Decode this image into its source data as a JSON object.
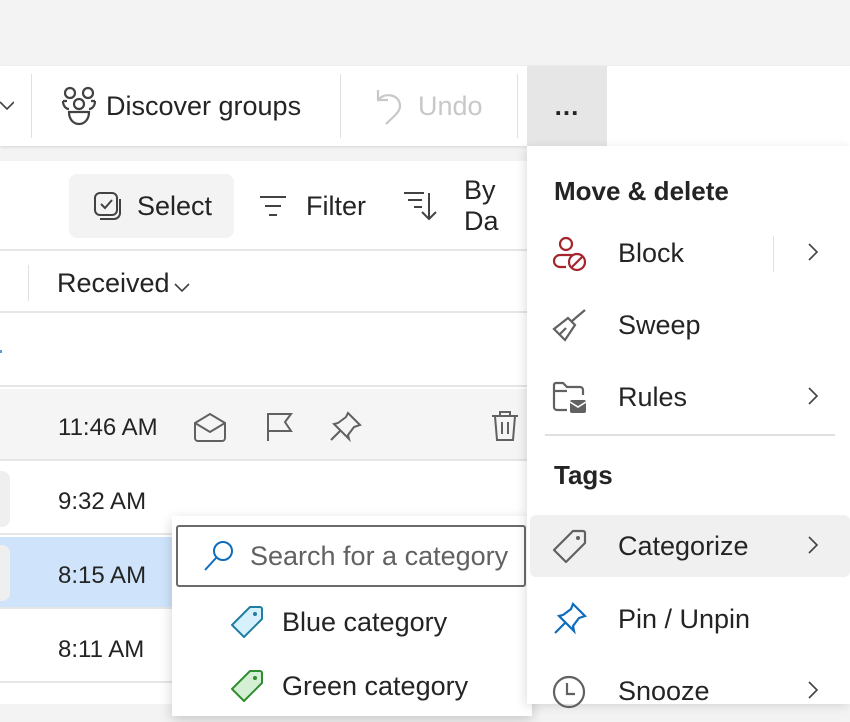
{
  "ribbon": {
    "discover_groups_label": "Discover groups",
    "undo_label": "Undo",
    "more_label": "..."
  },
  "list": {
    "commands": {
      "select_label": "Select",
      "filter_label": "Filter",
      "sort_label": "By Da"
    },
    "column_header": {
      "received_label": "Received"
    },
    "rows": [
      {
        "time": ""
      },
      {
        "time": "11:46 AM",
        "hover_actions": [
          "mark-read-icon",
          "flag-icon",
          "pin-icon",
          "delete-icon"
        ]
      },
      {
        "time": "9:32 AM"
      },
      {
        "time": "8:15 AM",
        "selected": true
      },
      {
        "time": "8:11 AM"
      }
    ]
  },
  "categorize_flyout": {
    "search_placeholder": "Search for a category",
    "categories": [
      {
        "label": "Blue category",
        "color": "#1f7ea1",
        "fill": "#d6f1fb"
      },
      {
        "label": "Green category",
        "color": "#2f8f2f",
        "fill": "#d5efd5"
      }
    ]
  },
  "menu": {
    "sections": [
      {
        "header": "Move & delete",
        "items": [
          {
            "label": "Block",
            "icon": "block-person-icon",
            "submenu": true,
            "split": true
          },
          {
            "label": "Sweep",
            "icon": "broom-icon",
            "submenu": false
          },
          {
            "label": "Rules",
            "icon": "rules-folder-icon",
            "submenu": true
          }
        ]
      },
      {
        "header": "Tags",
        "items": [
          {
            "label": "Categorize",
            "icon": "tag-icon",
            "submenu": true,
            "highlighted": true
          },
          {
            "label": "Pin / Unpin",
            "icon": "pin-icon",
            "submenu": false
          },
          {
            "label": "Snooze",
            "icon": "clock-icon",
            "submenu": true
          }
        ]
      }
    ]
  },
  "colors": {
    "accent": "#0f6cbd",
    "block_icon": "#a4262c",
    "selected_row": "#cfe4fa",
    "hover_row": "#f5f5f5"
  }
}
